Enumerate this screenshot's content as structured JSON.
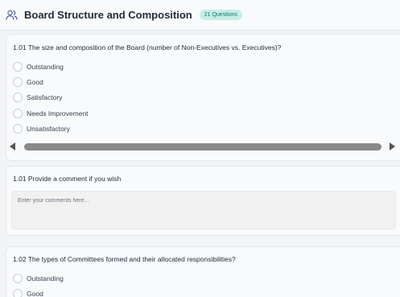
{
  "header": {
    "title": "Board Structure and Composition",
    "badge": "21 Questions",
    "icon": "users-icon"
  },
  "questions": [
    {
      "title": "1.01 The size and composition of the Board (number of Non-Executives vs. Executives)?",
      "options": [
        "Outstanding",
        "Good",
        "Satisfactory",
        "Needs Improvement",
        "Unsatisfactory"
      ]
    },
    {
      "title": "1.02 The types of Committees formed and their allocated responsibilities?",
      "options": [
        "Outstanding",
        "Good"
      ]
    }
  ],
  "comment": {
    "title": "1.01 Provide a comment if you wish",
    "placeholder": "Enter your comments here..."
  },
  "colors": {
    "badge_bg": "#c7ede6",
    "badge_text": "#0f766e",
    "icon_stroke": "#4f5ea8"
  }
}
